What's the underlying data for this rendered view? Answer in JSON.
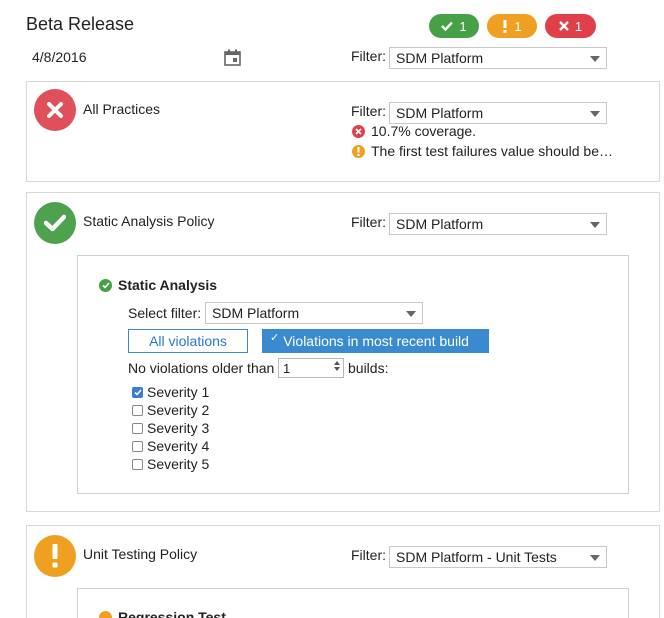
{
  "header": {
    "title": "Beta Release",
    "date": "4/8/2016",
    "filter_label": "Filter:",
    "filter_value": "SDM Platform",
    "badges": [
      {
        "count": "1",
        "status": "pass",
        "color": "#46a046",
        "icon": "check-icon"
      },
      {
        "count": "1",
        "status": "warning",
        "color": "#f0a020",
        "icon": "exclamation-icon"
      },
      {
        "count": "1",
        "status": "fail",
        "color": "#e0404a",
        "icon": "x-icon"
      }
    ]
  },
  "panels": [
    {
      "title": "All Practices",
      "status": "fail",
      "filter_label": "Filter:",
      "filter_value": "SDM Platform",
      "messages": [
        {
          "icon": "x-circle-icon",
          "text": "10.7% coverage."
        },
        {
          "icon": "warning-circle-icon",
          "text": "The first test failures value should be…"
        }
      ]
    },
    {
      "title": "Static Analysis Policy",
      "status": "pass",
      "filter_label": "Filter:",
      "filter_value": "SDM Platform",
      "sub": {
        "title": "Static Analysis",
        "select_label": "Select filter:",
        "select_value": "SDM Platform",
        "all_violations_label": "All violations",
        "recent_label": "Violations in most recent build",
        "older_prefix": "No violations older than",
        "older_value": "1",
        "older_suffix": "builds:",
        "severities": [
          {
            "label": "Severity 1",
            "checked": true
          },
          {
            "label": "Severity 2",
            "checked": false
          },
          {
            "label": "Severity 3",
            "checked": false
          },
          {
            "label": "Severity 4",
            "checked": false
          },
          {
            "label": "Severity 5",
            "checked": false
          }
        ]
      }
    },
    {
      "title": "Unit Testing Policy",
      "status": "warning",
      "filter_label": "Filter:",
      "filter_value": "SDM Platform - Unit Tests",
      "sub": {
        "title": "Regression Test"
      }
    }
  ],
  "colors": {
    "accent": "#3a8ad0",
    "pass": "#46a046",
    "warning": "#f0a020",
    "fail": "#e0404a"
  }
}
